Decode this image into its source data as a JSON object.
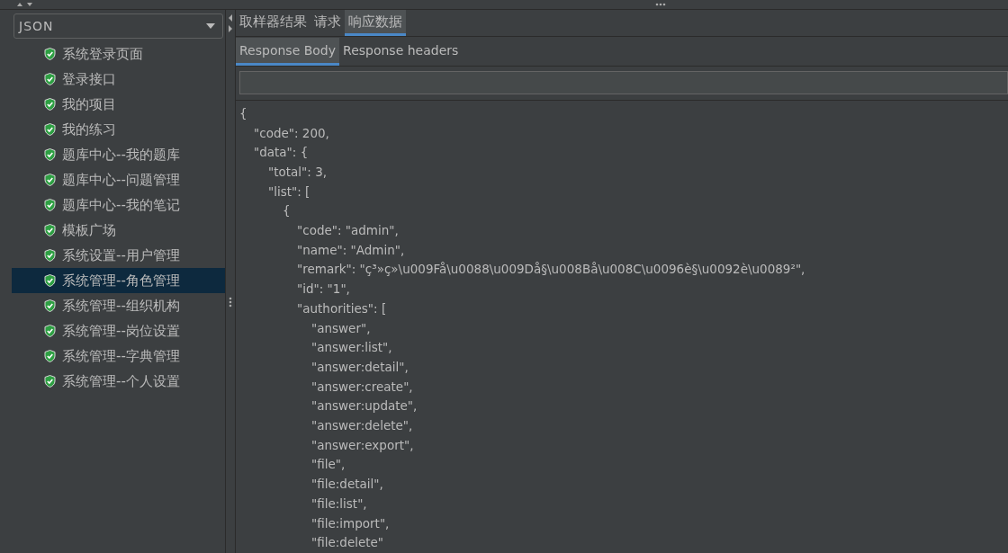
{
  "format_select": {
    "value": "JSON"
  },
  "samplers": [
    {
      "label": "系统登录页面",
      "selected": false
    },
    {
      "label": "登录接口",
      "selected": false
    },
    {
      "label": "我的项目",
      "selected": false
    },
    {
      "label": "我的练习",
      "selected": false
    },
    {
      "label": "题库中心--我的题库",
      "selected": false
    },
    {
      "label": "题库中心--问题管理",
      "selected": false
    },
    {
      "label": "题库中心--我的笔记",
      "selected": false
    },
    {
      "label": "模板广场",
      "selected": false
    },
    {
      "label": "系统设置--用户管理",
      "selected": false
    },
    {
      "label": "系统管理--角色管理",
      "selected": true
    },
    {
      "label": "系统管理--组织机构",
      "selected": false
    },
    {
      "label": "系统管理--岗位设置",
      "selected": false
    },
    {
      "label": "系统管理--字典管理",
      "selected": false
    },
    {
      "label": "系统管理--个人设置",
      "selected": false
    }
  ],
  "tabs": [
    {
      "label": "取样器结果",
      "selected": false
    },
    {
      "label": "请求",
      "selected": false
    },
    {
      "label": "响应数据",
      "selected": true
    }
  ],
  "subtabs": [
    {
      "label": "Response Body",
      "selected": true
    },
    {
      "label": "Response headers",
      "selected": false
    }
  ],
  "body_lines": [
    "{",
    "  \"code\": 200,",
    "  \"data\": {",
    "    \"total\": 3,",
    "    \"list\": [",
    "      {",
    "        \"code\": \"admin\",",
    "        \"name\": \"Admin\",",
    "        \"remark\": \"ç³»ç»\\u009Få\\u0088\\u009Då§\\u008Bå\\u008C\\u0096è§\\u0092è\\u0089²\",",
    "        \"id\": \"1\",",
    "        \"authorities\": [",
    "          \"answer\",",
    "          \"answer:list\",",
    "          \"answer:detail\",",
    "          \"answer:create\",",
    "          \"answer:update\",",
    "          \"answer:delete\",",
    "          \"answer:export\",",
    "          \"file\",",
    "          \"file:detail\",",
    "          \"file:list\",",
    "          \"file:import\",",
    "          \"file:delete\""
  ]
}
